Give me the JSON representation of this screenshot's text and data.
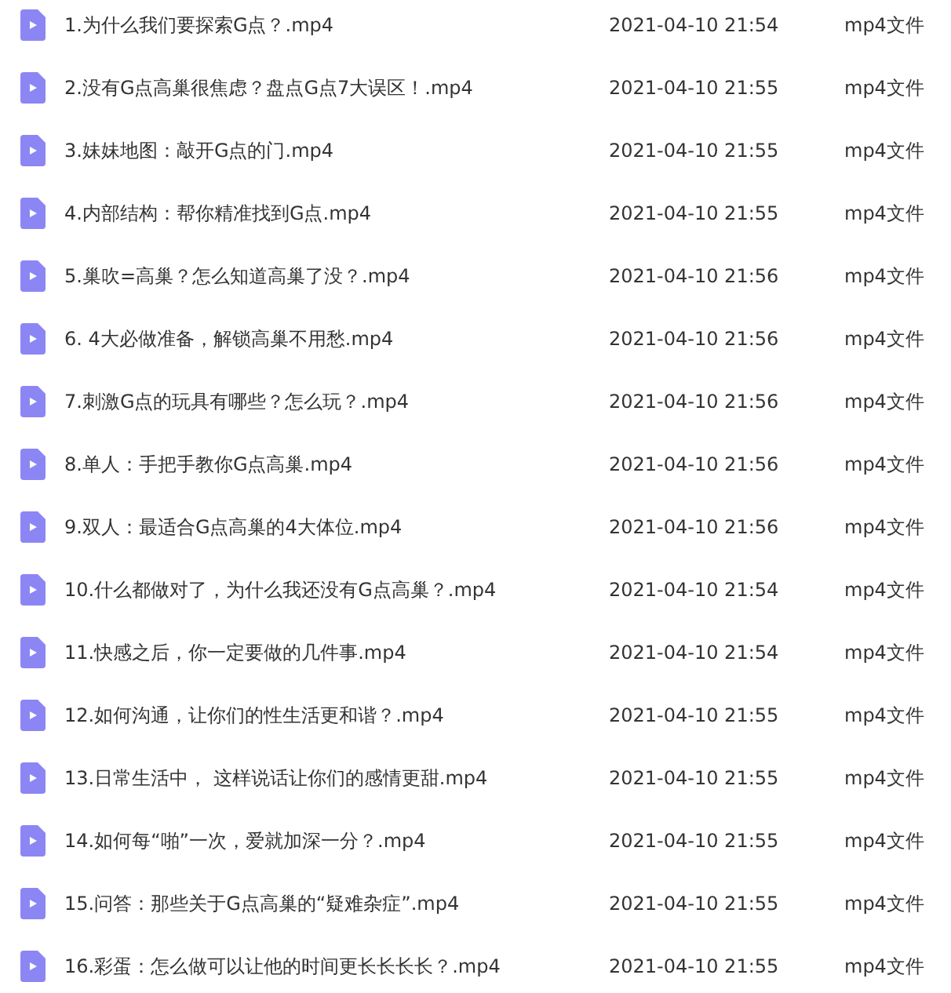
{
  "files": [
    {
      "name": "1.为什么我们要探索G点？.mp4",
      "modified": "2021-04-10 21:54",
      "type": "mp4文件"
    },
    {
      "name": "2.没有G点高巢很焦虑？盘点G点7大误区！.mp4",
      "modified": "2021-04-10 21:55",
      "type": "mp4文件"
    },
    {
      "name": "3.妹妹地图：敲开G点的门.mp4",
      "modified": "2021-04-10 21:55",
      "type": "mp4文件"
    },
    {
      "name": "4.内部结构：帮你精准找到G点.mp4",
      "modified": "2021-04-10 21:55",
      "type": "mp4文件"
    },
    {
      "name": "5.巢吹=高巢？怎么知道高巢了没？.mp4",
      "modified": "2021-04-10 21:56",
      "type": "mp4文件"
    },
    {
      "name": "6. 4大必做准备，解锁高巢不用愁.mp4",
      "modified": "2021-04-10 21:56",
      "type": "mp4文件"
    },
    {
      "name": "7.刺激G点的玩具有哪些？怎么玩？.mp4",
      "modified": "2021-04-10 21:56",
      "type": "mp4文件"
    },
    {
      "name": "8.单人：手把手教你G点高巢.mp4",
      "modified": "2021-04-10 21:56",
      "type": "mp4文件"
    },
    {
      "name": "9.双人：最适合G点高巢的4大体位.mp4",
      "modified": "2021-04-10 21:56",
      "type": "mp4文件"
    },
    {
      "name": "10.什么都做对了，为什么我还没有G点高巢？.mp4",
      "modified": "2021-04-10 21:54",
      "type": "mp4文件"
    },
    {
      "name": "11.快感之后，你一定要做的几件事.mp4",
      "modified": "2021-04-10 21:54",
      "type": "mp4文件"
    },
    {
      "name": "12.如何沟通，让你们的性生活更和谐？.mp4",
      "modified": "2021-04-10 21:55",
      "type": "mp4文件"
    },
    {
      "name": "13.日常生活中， 这样说话让你们的感情更甜.mp4",
      "modified": "2021-04-10 21:55",
      "type": "mp4文件"
    },
    {
      "name": "14.如何每“啪”一次，爱就加深一分？.mp4",
      "modified": "2021-04-10 21:55",
      "type": "mp4文件"
    },
    {
      "name": "15.问答：那些关于G点高巢的“疑难杂症”.mp4",
      "modified": "2021-04-10 21:55",
      "type": "mp4文件"
    },
    {
      "name": "16.彩蛋：怎么做可以让他的时间更长长长长？.mp4",
      "modified": "2021-04-10 21:55",
      "type": "mp4文件"
    }
  ]
}
